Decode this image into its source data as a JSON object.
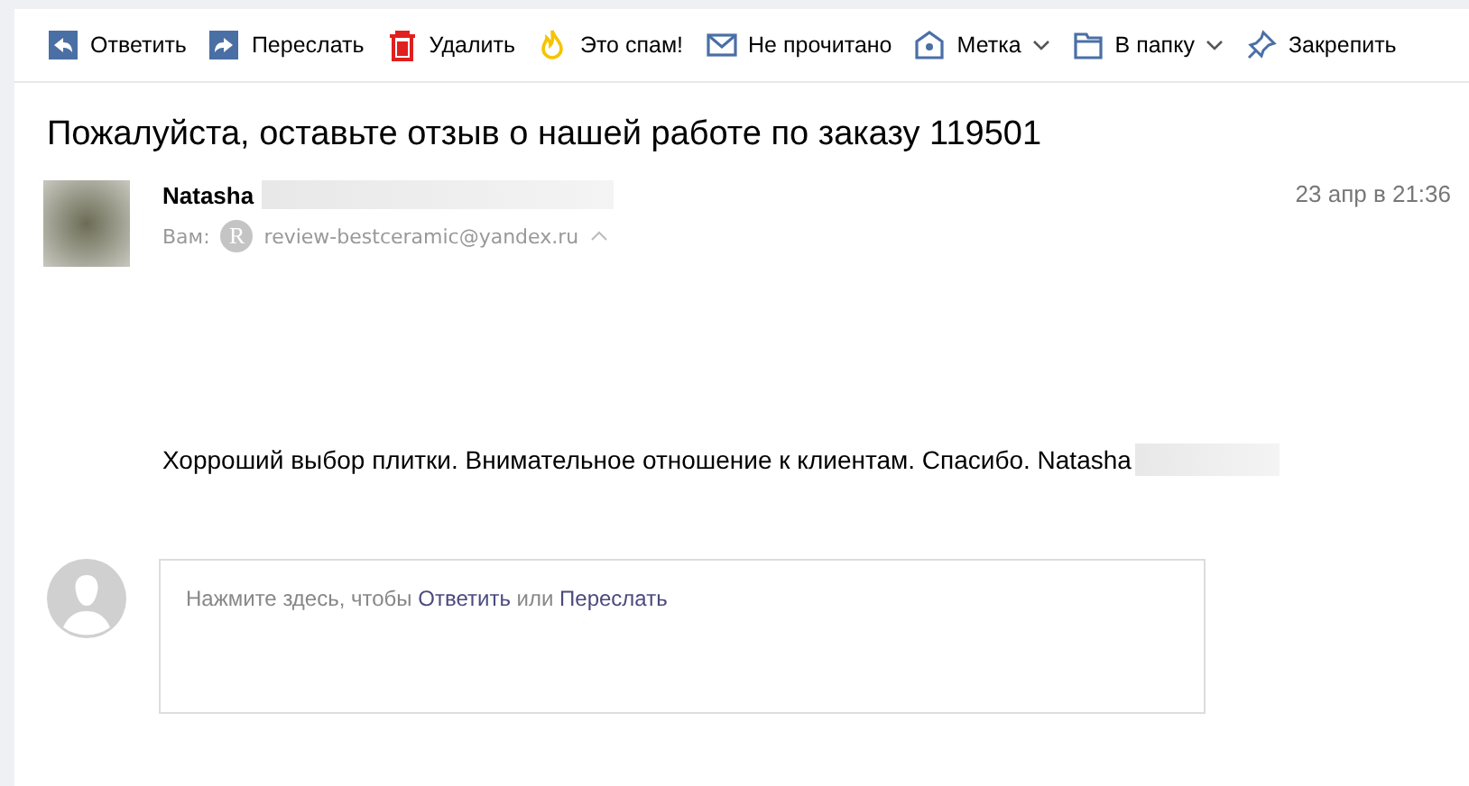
{
  "toolbar": [
    {
      "kind": "reply",
      "label": "Ответить",
      "dropdown": false
    },
    {
      "kind": "forward",
      "label": "Переслать",
      "dropdown": false
    },
    {
      "kind": "delete",
      "label": "Удалить",
      "dropdown": false
    },
    {
      "kind": "spam",
      "label": "Это спам!",
      "dropdown": false
    },
    {
      "kind": "unread",
      "label": "Не прочитано",
      "dropdown": false
    },
    {
      "kind": "label",
      "label": "Метка",
      "dropdown": true
    },
    {
      "kind": "folder",
      "label": "В папку",
      "dropdown": true
    },
    {
      "kind": "pin",
      "label": "Закрепить",
      "dropdown": false
    }
  ],
  "subject": "Пожалуйста, оставьте отзыв о нашей работе по заказу 119501",
  "message": {
    "sender": "Natasha",
    "to_label": "Вам:",
    "recipient_initial": "R",
    "recipient": "review-bestceramic@yandex.ru",
    "date": "23 апр в 21:36",
    "body": "Хорроший выбор плитки. Внимательное отношение к клиентам. Спасибо. Natasha"
  },
  "quick_reply": {
    "prompt": "Нажмите здесь, чтобы",
    "reply_link": "Ответить",
    "joiner": "или",
    "forward_link": "Переслать"
  }
}
